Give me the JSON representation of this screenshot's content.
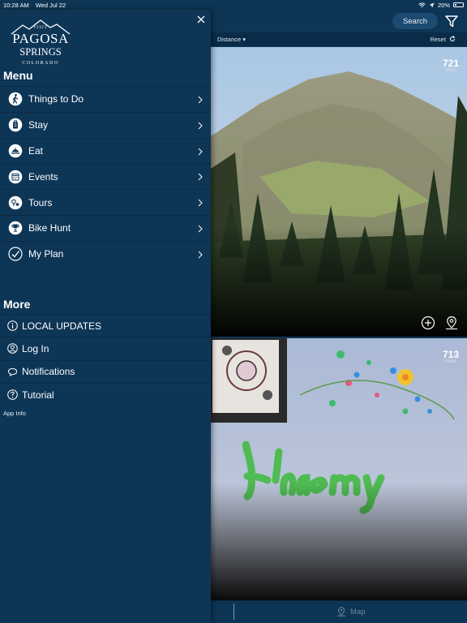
{
  "status_bar": {
    "time": "10:28 AM",
    "date": "Wed Jul 22",
    "battery": "20%"
  },
  "header": {
    "search_label": "Search"
  },
  "sort_bar": {
    "sort_label": "Distance ▾",
    "reset_label": "Reset"
  },
  "cards": [
    {
      "distance": "721",
      "unit": "Miles"
    },
    {
      "distance": "713",
      "unit": "Miles"
    }
  ],
  "bottom_nav": {
    "map_label": "Map"
  },
  "drawer": {
    "logo": {
      "line1": "VISIT",
      "line2": "PAGOSA",
      "line3": "SPRINGS",
      "line4": "COLORADO"
    },
    "menu_title": "Menu",
    "menu_items": [
      {
        "label": "Things to Do",
        "icon": "hiker-icon"
      },
      {
        "label": "Stay",
        "icon": "luggage-icon"
      },
      {
        "label": "Eat",
        "icon": "food-icon"
      },
      {
        "label": "Events",
        "icon": "calendar-icon"
      },
      {
        "label": "Tours",
        "icon": "tour-map-icon"
      },
      {
        "label": "Bike Hunt",
        "icon": "trophy-icon"
      },
      {
        "label": "My Plan",
        "icon": "checkmark-icon"
      }
    ],
    "more_title": "More",
    "more_items": [
      {
        "label": "LOCAL UPDATES",
        "icon": "info-icon"
      },
      {
        "label": "Log In",
        "icon": "user-icon"
      },
      {
        "label": "Notifications",
        "icon": "speech-bubble-icon"
      },
      {
        "label": "Tutorial",
        "icon": "question-icon"
      }
    ],
    "app_info": "App Info"
  }
}
